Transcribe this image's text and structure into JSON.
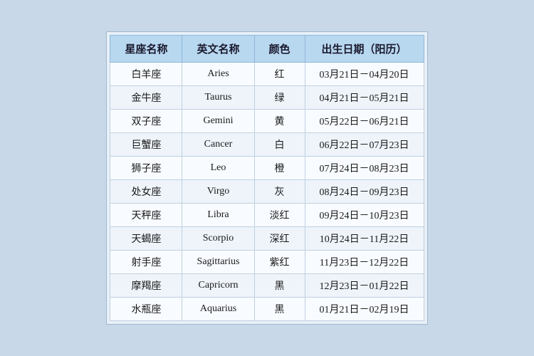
{
  "table": {
    "headers": [
      "星座名称",
      "英文名称",
      "颜色",
      "出生日期（阳历）"
    ],
    "rows": [
      {
        "chinese": "白羊座",
        "english": "Aries",
        "color": "红",
        "dates": "03月21日－04月20日"
      },
      {
        "chinese": "金牛座",
        "english": "Taurus",
        "color": "绿",
        "dates": "04月21日－05月21日"
      },
      {
        "chinese": "双子座",
        "english": "Gemini",
        "color": "黄",
        "dates": "05月22日－06月21日"
      },
      {
        "chinese": "巨蟹座",
        "english": "Cancer",
        "color": "白",
        "dates": "06月22日－07月23日"
      },
      {
        "chinese": "狮子座",
        "english": "Leo",
        "color": "橙",
        "dates": "07月24日－08月23日"
      },
      {
        "chinese": "处女座",
        "english": "Virgo",
        "color": "灰",
        "dates": "08月24日－09月23日"
      },
      {
        "chinese": "天秤座",
        "english": "Libra",
        "color": "淡红",
        "dates": "09月24日－10月23日"
      },
      {
        "chinese": "天蝎座",
        "english": "Scorpio",
        "color": "深红",
        "dates": "10月24日－11月22日"
      },
      {
        "chinese": "射手座",
        "english": "Sagittarius",
        "color": "紫红",
        "dates": "11月23日－12月22日"
      },
      {
        "chinese": "摩羯座",
        "english": "Capricorn",
        "color": "黑",
        "dates": "12月23日－01月22日"
      },
      {
        "chinese": "水瓶座",
        "english": "Aquarius",
        "color": "黑",
        "dates": "01月21日－02月19日"
      }
    ]
  }
}
